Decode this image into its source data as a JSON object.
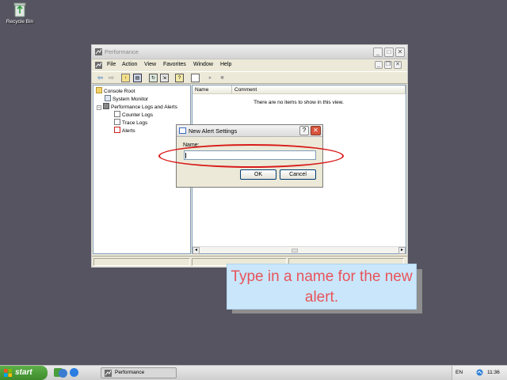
{
  "desktop": {
    "recycle_bin_label": "Recycle Bin"
  },
  "window": {
    "title": "Performance",
    "menu": [
      "File",
      "Action",
      "View",
      "Favorites",
      "Window",
      "Help"
    ],
    "tree": {
      "root": "Console Root",
      "items": [
        "System Monitor",
        "Performance Logs and Alerts",
        "Counter Logs",
        "Trace Logs",
        "Alerts"
      ]
    },
    "columns": [
      "Name",
      "Comment"
    ],
    "empty_message": "There are no items to show in this view."
  },
  "dialog": {
    "title": "New Alert Settings",
    "help_label": "?",
    "close_label": "✕",
    "name_label": "Name:",
    "name_value": "",
    "ok_label": "OK",
    "cancel_label": "Cancel"
  },
  "callout": {
    "text": "Type in a name for the new alert."
  },
  "taskbar": {
    "start_label": "start",
    "task_label": "Performance",
    "language": "EN",
    "clock": "11:36"
  },
  "colors": {
    "highlight": "#d81b1b",
    "callout_bg": "#c9e6fb",
    "callout_text": "#e8545a"
  }
}
